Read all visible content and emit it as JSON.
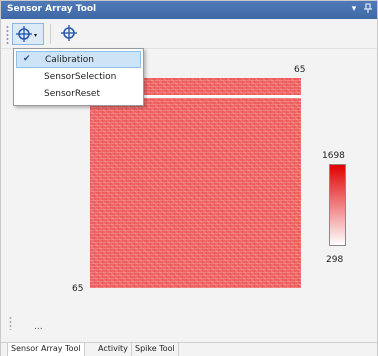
{
  "window": {
    "title": "Sensor Array Tool",
    "dropdown_glyph": "▾",
    "pin_glyph": "ꟷ"
  },
  "toolbar": {
    "tool_icon": "crosshair-icon",
    "caret": "▾"
  },
  "menu": {
    "items": [
      {
        "label": "Calibration",
        "checked": true
      },
      {
        "label": "SensorSelection",
        "checked": false
      },
      {
        "label": "SensorReset",
        "checked": false
      }
    ],
    "check_glyph": "✔"
  },
  "plot": {
    "top_right_label": "65",
    "bottom_left_label": "65",
    "colorbar": {
      "max": "1698",
      "min": "298",
      "high_color": "#e00000",
      "low_color": "#ffffff"
    },
    "fill_color": "#f06262"
  },
  "status": {
    "text": "..."
  },
  "tabs": [
    {
      "label": "Sensor Array Tool",
      "active": true
    },
    {
      "label": "Activity",
      "active": false
    },
    {
      "label": "Spike Tool",
      "active": false
    }
  ]
}
